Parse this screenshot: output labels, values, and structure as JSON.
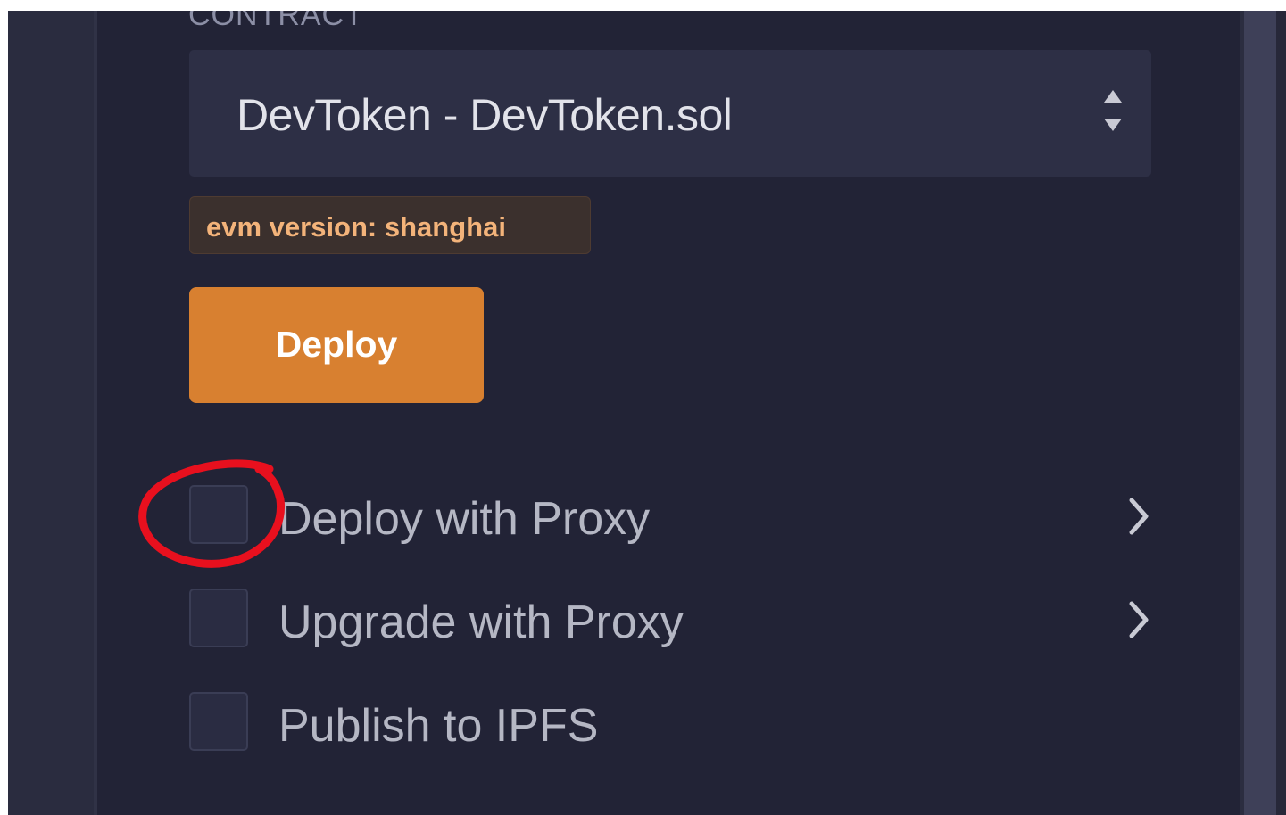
{
  "section_label": "CONTRACT",
  "contract_select": {
    "value": "DevToken - DevToken.sol",
    "icon": "up-down-arrows-icon"
  },
  "badge": {
    "text": "evm version: shanghai"
  },
  "deploy_button": {
    "label": "Deploy"
  },
  "options": [
    {
      "label": "Deploy with Proxy",
      "checked": false,
      "has_chevron": true
    },
    {
      "label": "Upgrade with Proxy",
      "checked": false,
      "has_chevron": true
    },
    {
      "label": "Publish to IPFS",
      "checked": false,
      "has_chevron": false
    }
  ],
  "annotation": {
    "type": "red-hand-drawn-circle",
    "target": "deploy-with-proxy-checkbox"
  },
  "colors": {
    "panel_bg": "#222336",
    "select_bg": "#2d2f45",
    "accent": "#d88030",
    "badge_text": "#f3b37a",
    "badge_bg": "#3b302d",
    "annotation_red": "#e8101e"
  }
}
